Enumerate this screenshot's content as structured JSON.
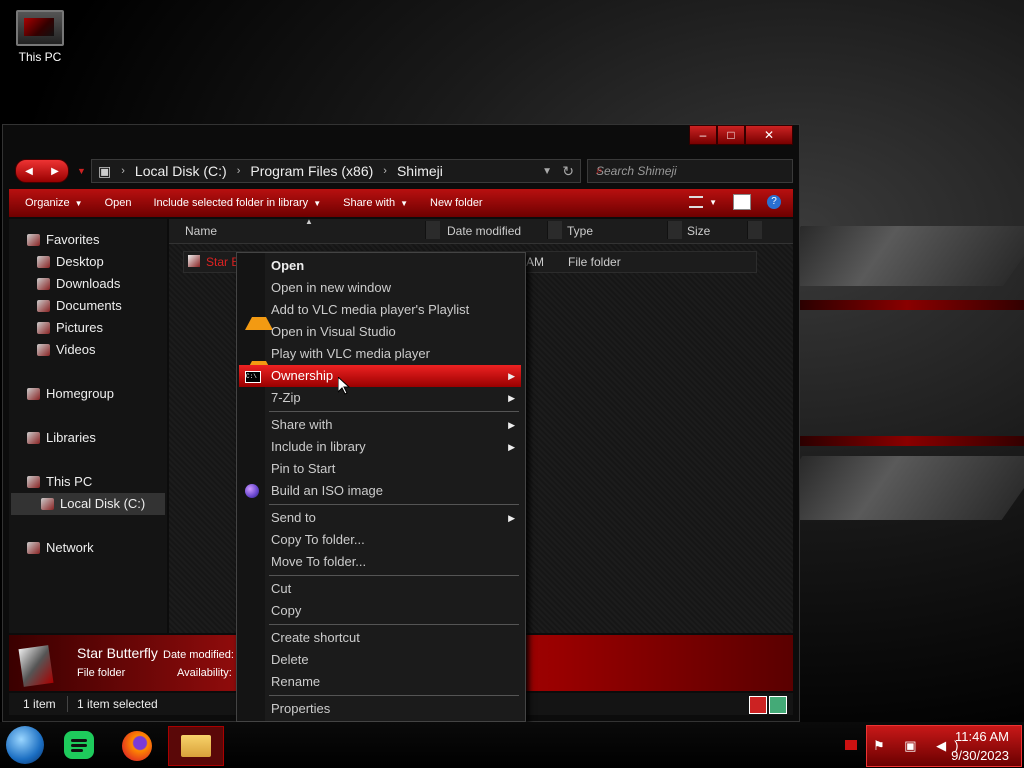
{
  "desktop": {
    "icon_label": "This PC"
  },
  "window": {
    "caption": {
      "minimize": "–",
      "maximize": "□",
      "close": "✕"
    },
    "address": {
      "crumbs": [
        "Local Disk (C:)",
        "Program Files (x86)",
        "Shimeji"
      ]
    },
    "search": {
      "placeholder": "Search Shimeji"
    },
    "toolbar": {
      "organize": "Organize",
      "open": "Open",
      "include": "Include selected folder in library",
      "share": "Share with",
      "new_folder": "New folder"
    },
    "nav": {
      "favorites": "Favorites",
      "desktop": "Desktop",
      "downloads": "Downloads",
      "documents": "Documents",
      "pictures": "Pictures",
      "videos": "Videos",
      "homegroup": "Homegroup",
      "libraries": "Libraries",
      "this_pc": "This PC",
      "local_disk": "Local Disk (C:)",
      "network": "Network"
    },
    "columns": {
      "name": "Name",
      "date": "Date modified",
      "type": "Type",
      "size": "Size"
    },
    "file": {
      "name": "Star B",
      "date_tail": "AM",
      "type": "File folder"
    },
    "details": {
      "name": "Star Butterfly",
      "type": "File folder",
      "modified_label": "Date modified:",
      "availability_label": "Availability:"
    },
    "status": {
      "count": "1 item",
      "selected": "1 item selected"
    }
  },
  "context_menu": {
    "open": "Open",
    "open_new_window": "Open in new window",
    "add_vlc_playlist": "Add to VLC media player's Playlist",
    "open_vs": "Open in Visual Studio",
    "play_vlc": "Play with VLC media player",
    "ownership": "Ownership",
    "sevenzip": "7-Zip",
    "share_with": "Share with",
    "include_library": "Include in library",
    "pin_start": "Pin to Start",
    "build_iso": "Build an ISO image",
    "send_to": "Send to",
    "copy_to": "Copy To folder...",
    "move_to": "Move To folder...",
    "cut": "Cut",
    "copy": "Copy",
    "create_shortcut": "Create shortcut",
    "delete": "Delete",
    "rename": "Rename",
    "properties": "Properties",
    "cmd_icon_text": "C:\\"
  },
  "taskbar": {
    "tray_icons": "⚑ ▣ ◀)",
    "time": "11:46 AM",
    "date": "9/30/2023"
  }
}
